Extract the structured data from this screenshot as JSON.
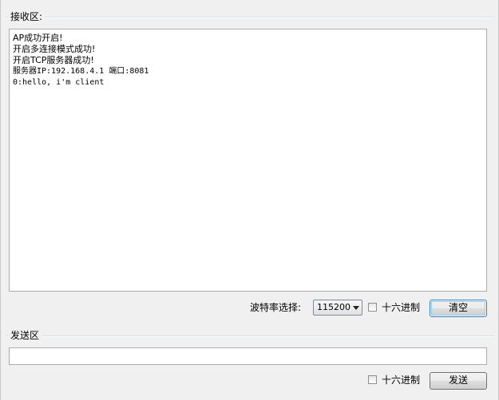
{
  "receive": {
    "title": "接收区:",
    "lines": [
      "AP成功开启!",
      "开启多连接模式成功!",
      "开启TCP服务器成功!",
      "服务器IP:192.168.4.1 端口:8081",
      "0:hello, i'm client"
    ]
  },
  "controls": {
    "baud_label": "波特率选择:",
    "baud_value": "115200",
    "hex_receive_label": "十六进制",
    "clear_button": "清空"
  },
  "send": {
    "title": "发送区",
    "input_value": "",
    "hex_send_label": "十六进制",
    "send_button": "发送"
  }
}
